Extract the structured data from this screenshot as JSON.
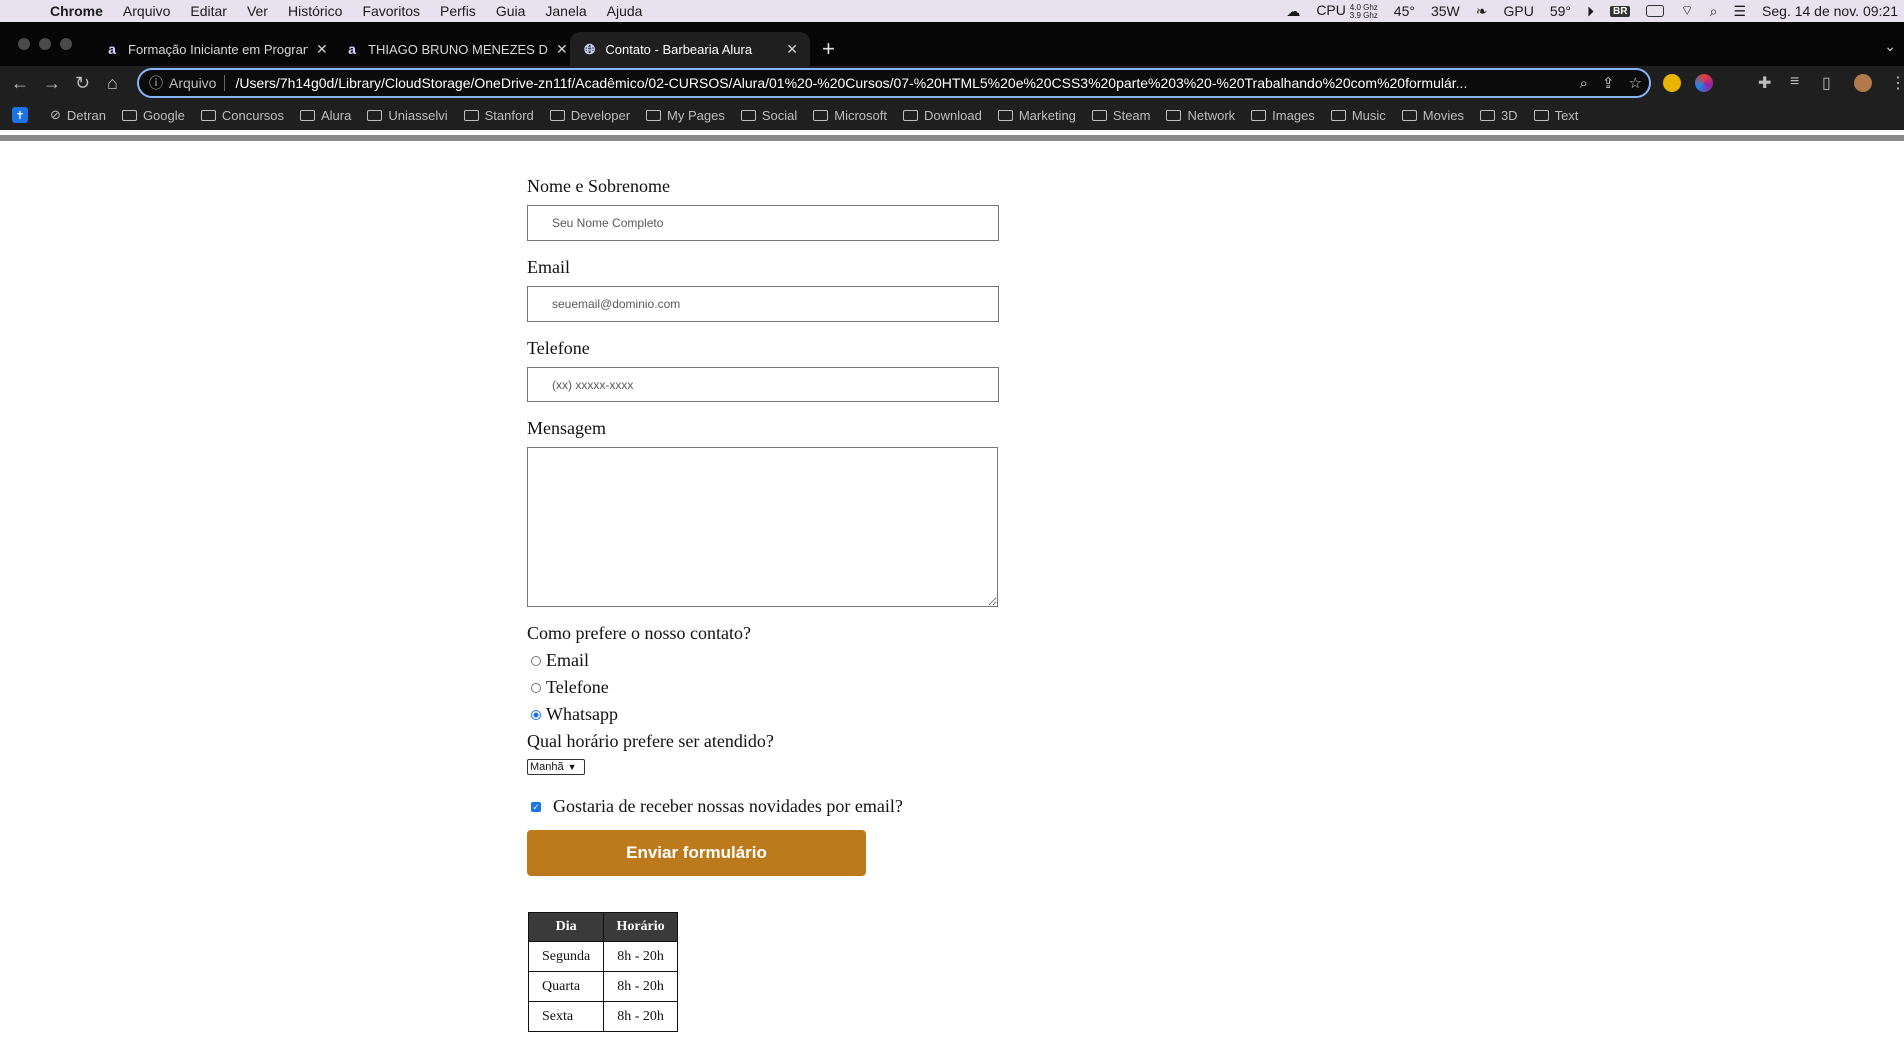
{
  "os_menubar": {
    "app": "Chrome",
    "menus": [
      "Arquivo",
      "Editar",
      "Ver",
      "Histórico",
      "Favoritos",
      "Perfis",
      "Guia",
      "Janela",
      "Ajuda"
    ],
    "cpu_label": "CPU",
    "cpu_freq_top": "4.0 Ghz",
    "cpu_freq_bottom": "3.9 Ghz",
    "temp": "45°",
    "power": "35W",
    "gpu_label": "GPU",
    "gpu_temp": "59°",
    "lang": "BR",
    "datetime": "Seg. 14 de nov.  09:21"
  },
  "tabs": [
    {
      "title": "Formação Iniciante em Progran",
      "favicon": "a"
    },
    {
      "title": "THIAGO BRUNO MENEZES DA",
      "favicon": "a"
    },
    {
      "title": "Contato - Barbearia Alura",
      "favicon": "globe"
    }
  ],
  "omnibox": {
    "scheme_label": "Arquivo",
    "url": "/Users/7h14g0d/Library/CloudStorage/OneDrive-zn11f/Acadêmico/02-CURSOS/Alura/01%20-%20Cursos/07-%20HTML5%20e%20CSS3%20parte%203%20-%20Trabalhando%20com%20formulár..."
  },
  "bookmarks": [
    "Detran",
    "Google",
    "Concursos",
    "Alura",
    "Uniasselvi",
    "Stanford",
    "Developer",
    "My Pages",
    "Social",
    "Microsoft",
    "Download",
    "Marketing",
    "Steam",
    "Network",
    "Images",
    "Music",
    "Movies",
    "3D",
    "Text"
  ],
  "form": {
    "name_label": "Nome e Sobrenome",
    "name_placeholder": "Seu Nome Completo",
    "email_label": "Email",
    "email_placeholder": "seuemail@dominio.com",
    "phone_label": "Telefone",
    "phone_placeholder": "(xx) xxxxx-xxxx",
    "message_label": "Mensagem",
    "contact_question": "Como prefere o nosso contato?",
    "contact_options": [
      {
        "label": "Email",
        "checked": false
      },
      {
        "label": "Telefone",
        "checked": false
      },
      {
        "label": "Whatsapp",
        "checked": true
      }
    ],
    "time_question": "Qual horário prefere ser atendido?",
    "time_selected": "Manhã",
    "newsletter_label": "Gostaria de receber nossas novidades por email?",
    "newsletter_checked": true,
    "submit_label": "Enviar formulário",
    "submit_color": "#bc7a1c"
  },
  "hours_table": {
    "headers": [
      "Dia",
      "Horário"
    ],
    "rows": [
      [
        "Segunda",
        "8h - 20h"
      ],
      [
        "Quarta",
        "8h - 20h"
      ],
      [
        "Sexta",
        "8h - 20h"
      ]
    ]
  }
}
